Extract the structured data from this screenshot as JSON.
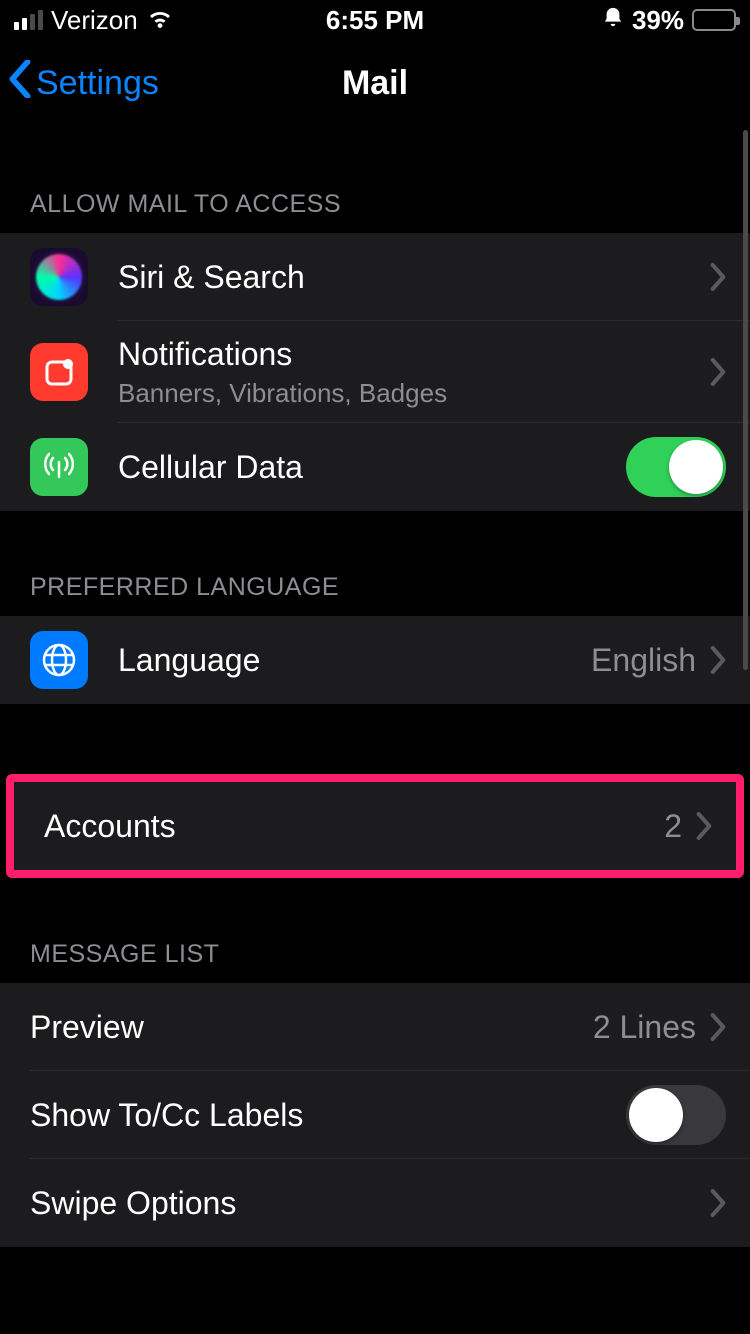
{
  "status": {
    "carrier": "Verizon",
    "time": "6:55 PM",
    "battery_pct": "39%"
  },
  "nav": {
    "back_label": "Settings",
    "title": "Mail"
  },
  "sections": {
    "access": {
      "header": "Allow Mail to Access",
      "siri": "Siri & Search",
      "notifications": "Notifications",
      "notifications_sub": "Banners, Vibrations, Badges",
      "cellular": "Cellular Data",
      "cellular_on": true
    },
    "language": {
      "header": "Preferred Language",
      "label": "Language",
      "value": "English"
    },
    "accounts": {
      "label": "Accounts",
      "value": "2"
    },
    "message_list": {
      "header": "Message List",
      "preview": "Preview",
      "preview_value": "2 Lines",
      "show_tocc": "Show To/Cc Labels",
      "show_tocc_on": false,
      "swipe": "Swipe Options"
    }
  }
}
